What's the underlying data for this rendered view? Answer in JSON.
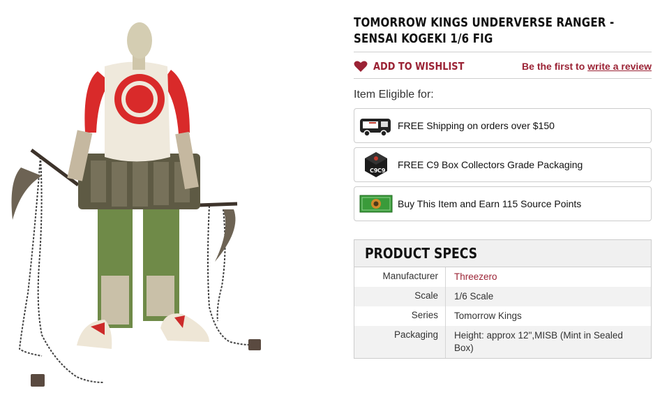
{
  "product": {
    "title": "TOMORROW KINGS UNDERVERSE RANGER - SENSAI KOGEKI 1/6 FIG",
    "image_alt": "Tomorrow Kings Underverse Ranger Sensai Kogeki figure with sickles and chains"
  },
  "wishlist": {
    "label": "ADD TO WISHLIST",
    "icon": "heart-icon"
  },
  "review": {
    "prefix": "Be the first to",
    "link": "write a review"
  },
  "eligible": {
    "title": "Item Eligible for:",
    "items": [
      {
        "icon": "shipping-truck-icon",
        "text": "FREE Shipping  on orders over $150"
      },
      {
        "icon": "c9-box-icon",
        "text": "FREE C9 Box Collectors Grade Packaging"
      },
      {
        "icon": "source-points-icon",
        "text": "Buy This Item and Earn 115 Source Points"
      }
    ]
  },
  "specs": {
    "heading": "PRODUCT SPECS",
    "rows": [
      {
        "key": "Manufacturer",
        "value": "Threezero"
      },
      {
        "key": "Scale",
        "value": "1/6 Scale"
      },
      {
        "key": "Series",
        "value": "Tomorrow Kings"
      },
      {
        "key": "Packaging",
        "value": "Height: approx 12\",MISB (Mint in Sealed Box)"
      }
    ]
  },
  "colors": {
    "accent": "#9b2335",
    "border": "#cccccc",
    "spec_stripe": "#f2f2f2"
  }
}
